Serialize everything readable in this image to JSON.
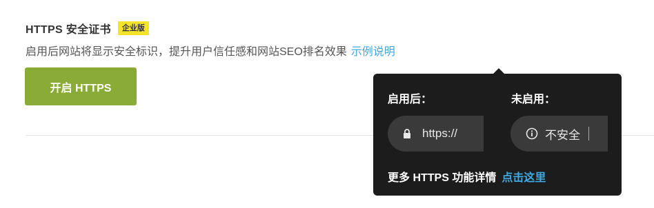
{
  "section": {
    "title": "HTTPS 安全证书",
    "badge": "企业版",
    "description": "启用后网站将显示安全标识，提升用户信任感和网站SEO排名效果",
    "example_link": "示例说明",
    "enable_button": "开启 HTTPS"
  },
  "popover": {
    "enabled_label": "启用后：",
    "disabled_label": "未启用：",
    "enabled_url": "https://",
    "disabled_status": "不安全",
    "footer_text": "更多 HTTPS 功能详情",
    "footer_link": "点击这里"
  },
  "colors": {
    "accent_green": "#8aab35",
    "badge_yellow": "#f7e22a",
    "link_blue": "#40a9e0",
    "popover_bg": "#1c1c1c"
  }
}
